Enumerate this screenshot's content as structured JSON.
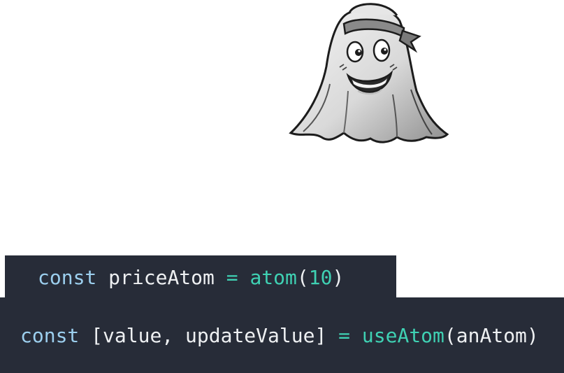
{
  "illustration": {
    "subject": "ghost-mascot-icon"
  },
  "colors": {
    "code_background": "#272c38",
    "keyword": "#9ccfee",
    "identifier": "#eef0f2",
    "function": "#3fd1b3",
    "number": "#3fd1b3"
  },
  "code_line_1": {
    "keyword": "const",
    "name": "priceAtom",
    "operator": "=",
    "function": "atom",
    "open_paren": "(",
    "argument": "10",
    "close_paren": ")"
  },
  "code_line_2": {
    "keyword": "const",
    "destructure": "[value, updateValue]",
    "operator": "=",
    "function": "useAtom",
    "open_paren": "(",
    "argument": "anAtom",
    "close_paren": ")"
  }
}
